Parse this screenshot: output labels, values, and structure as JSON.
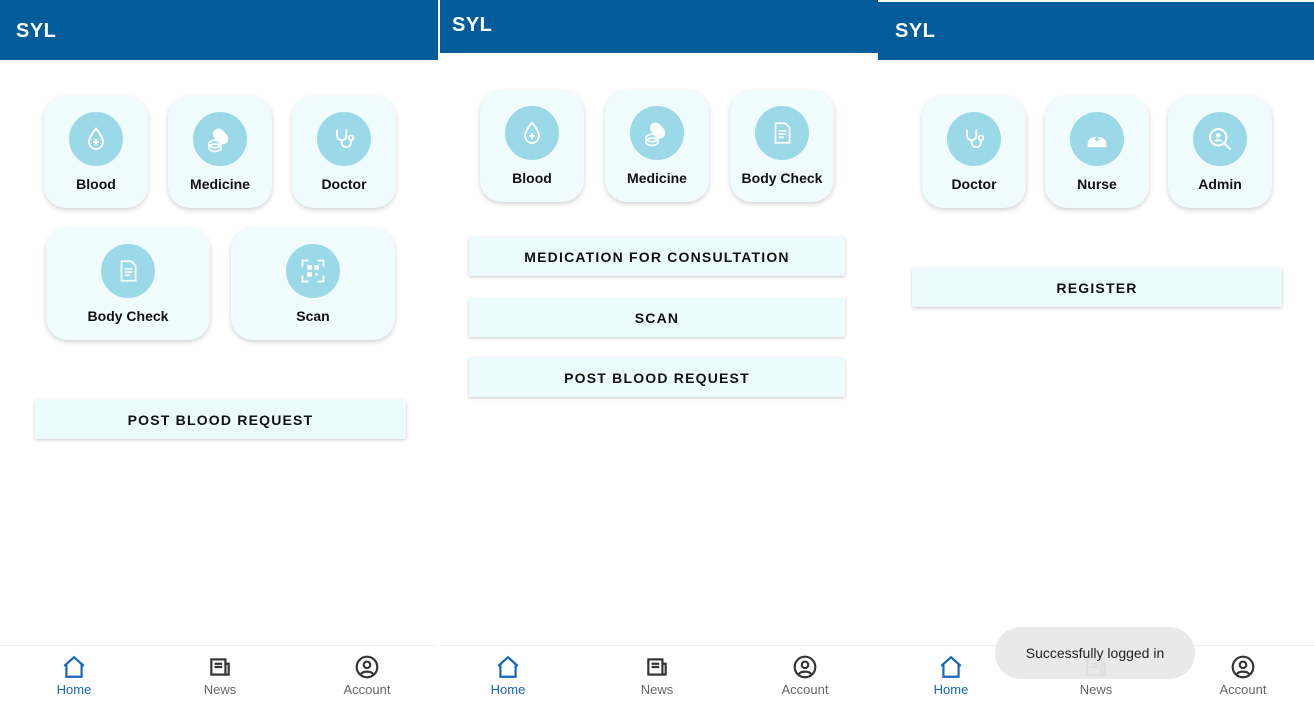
{
  "theme": {
    "appbar_color": "#015c9c",
    "tile_bg": "#f0fcfd",
    "icon_circle": "#9cd9e8",
    "active_nav": "#1565c0"
  },
  "screens": [
    {
      "title": "SYL",
      "tiles": [
        {
          "label": "Blood",
          "icon": "blood-drop-icon"
        },
        {
          "label": "Medicine",
          "icon": "pill-icon"
        },
        {
          "label": "Doctor",
          "icon": "stethoscope-icon"
        },
        {
          "label": "Body Check",
          "icon": "document-icon"
        },
        {
          "label": "Scan",
          "icon": "qr-scan-icon"
        }
      ],
      "buttons": [
        "POST BLOOD REQUEST"
      ],
      "nav": [
        {
          "label": "Home",
          "icon": "home-icon",
          "active": true
        },
        {
          "label": "News",
          "icon": "news-icon"
        },
        {
          "label": "Account",
          "icon": "account-icon"
        }
      ]
    },
    {
      "title": "SYL",
      "tiles": [
        {
          "label": "Blood",
          "icon": "blood-drop-icon"
        },
        {
          "label": "Medicine",
          "icon": "pill-icon"
        },
        {
          "label": "Body Check",
          "icon": "document-icon"
        }
      ],
      "buttons": [
        "MEDICATION FOR CONSULTATION",
        "SCAN",
        "POST BLOOD REQUEST"
      ],
      "nav": [
        {
          "label": "Home",
          "icon": "home-icon",
          "active": true
        },
        {
          "label": "News",
          "icon": "news-icon"
        },
        {
          "label": "Account",
          "icon": "account-icon"
        }
      ]
    },
    {
      "title": "SYL",
      "tiles": [
        {
          "label": "Doctor",
          "icon": "stethoscope-icon"
        },
        {
          "label": "Nurse",
          "icon": "nurse-cap-icon"
        },
        {
          "label": "Admin",
          "icon": "admin-search-icon"
        }
      ],
      "buttons": [
        "REGISTER"
      ],
      "nav": [
        {
          "label": "Home",
          "icon": "home-icon",
          "active": true
        },
        {
          "label": "News",
          "icon": "news-icon"
        },
        {
          "label": "Account",
          "icon": "account-icon"
        }
      ],
      "toast": "Successfully logged in"
    }
  ]
}
